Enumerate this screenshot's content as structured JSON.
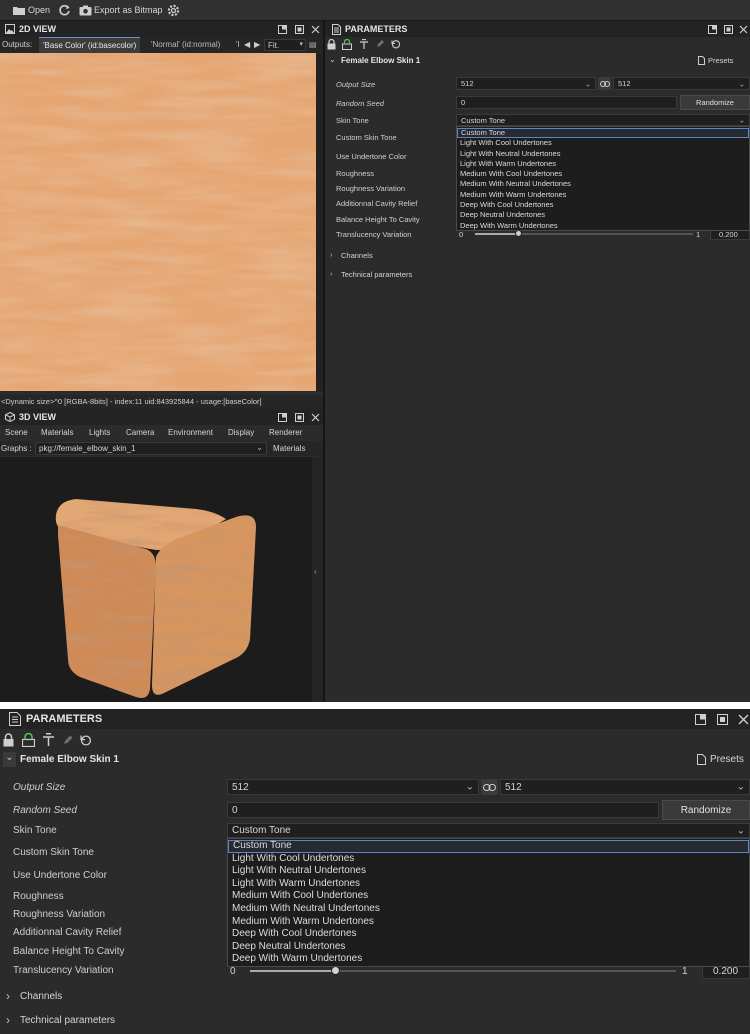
{
  "toolbar": {
    "open_label": "Open",
    "export_label": "Export as Bitmap"
  },
  "view2d": {
    "title": "2D VIEW",
    "outputs_label": "Outputs:",
    "tabs": [
      "'Base Color' (id:basecolor)",
      "'Normal' (id:normal)",
      "'I"
    ],
    "fit_label": "Fit.",
    "status": "<Dynamic size>^0 [RGBA-8bits] - index:11 uid:843925844 - usage:[baseColor]"
  },
  "view3d": {
    "title": "3D VIEW",
    "menu": [
      "Scene",
      "Materials",
      "Lights",
      "Camera",
      "Environment",
      "Display",
      "Renderer"
    ],
    "graphs_label": "Graphs :",
    "graph_value": "pkg://female_elbow_skin_1",
    "materials_label": "Materials"
  },
  "params": {
    "title": "PARAMETERS",
    "graph_name": "Female Elbow Skin 1",
    "presets_label": "Presets",
    "output_size_label": "Output Size",
    "output_size_w": "512",
    "output_size_h": "512",
    "random_seed_label": "Random Seed",
    "random_seed_value": "0",
    "randomize_label": "Randomize",
    "skin_tone_label": "Skin Tone",
    "skin_tone_value": "Custom Tone",
    "custom_skin_tone_label": "Custom Skin Tone",
    "use_undertone_label": "Use Undertone Color",
    "roughness_label": "Roughness",
    "roughness_variation_label": "Roughness Variation",
    "cavity_label": "Additionnal Cavity Relief",
    "balance_label": "Balance Height To Cavity",
    "translucency_label": "Translucency Variation",
    "slider_min": "0",
    "slider_max": "1",
    "translucency_value": "0.200",
    "translucency_level": 0.2,
    "channels_label": "Channels",
    "technical_label": "Technical parameters",
    "dropdown_options": [
      "Custom Tone",
      "Light With Cool Undertones",
      "Light With Neutral Undertones",
      "Light With Warm Undertones",
      "Medium With Cool Undertones",
      "Medium With Neutral Undertones",
      "Medium With Warm Undertones",
      "Deep With Cool Undertones",
      "Deep Neutral Undertones",
      "Deep With Warm Undertones"
    ]
  },
  "colors": {
    "panel_bg": "#2b2b2b",
    "header_bg": "#232323",
    "skin_light": "#e8a873",
    "skin_dark": "#c98350",
    "selection_border": "#5d86c4"
  }
}
